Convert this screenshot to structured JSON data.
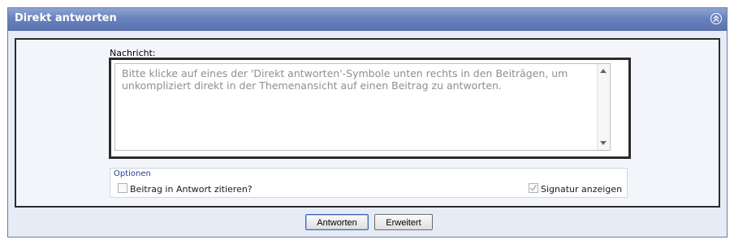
{
  "panel": {
    "title": "Direkt antworten",
    "collapse_icon": "double-chevron-up-icon"
  },
  "form": {
    "message_label": "Nachricht:",
    "message_text": "Bitte klicke auf eines der 'Direkt antworten'-Symbole unten rechts in den Beiträgen, um unkompliziert direkt in der Themenansicht auf einen Beitrag zu antworten.",
    "options": {
      "title": "Optionen",
      "quote_label": "Beitrag in Antwort zitieren?",
      "quote_checked": false,
      "signature_label": "Signatur anzeigen",
      "signature_checked": true,
      "signature_disabled": true
    }
  },
  "buttons": {
    "answer": "Antworten",
    "extended": "Erweitert"
  },
  "colors": {
    "header_gradient_top": "#8da4d2",
    "header_gradient_bottom": "#5a74b1",
    "panel_background": "#e6ebf5",
    "options_title": "#1f3f8f"
  }
}
